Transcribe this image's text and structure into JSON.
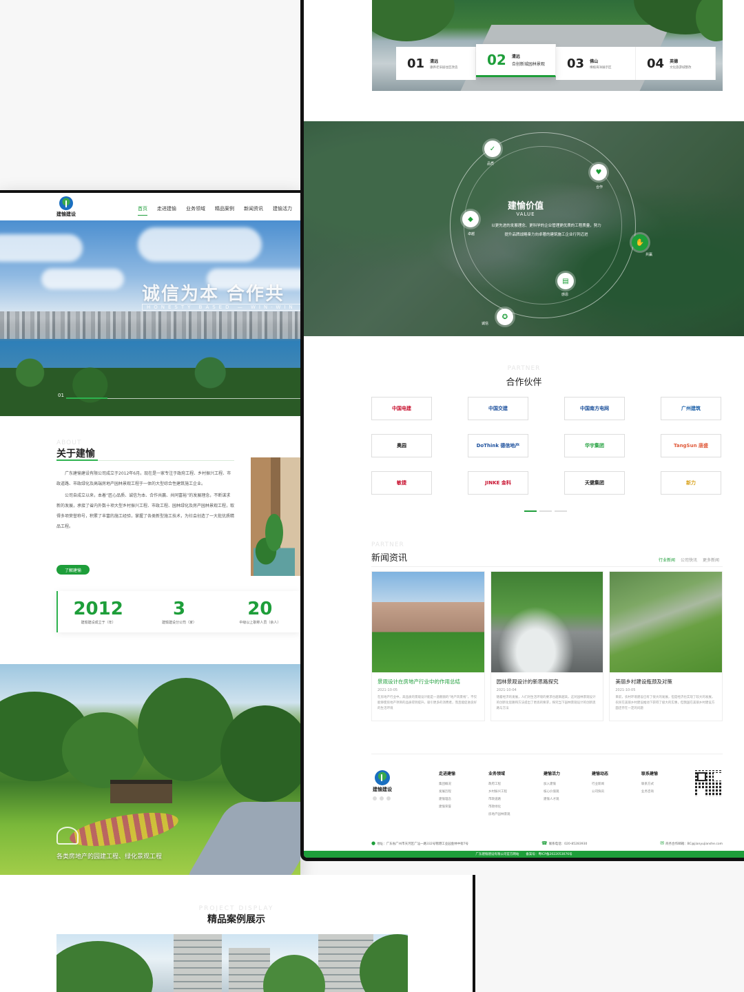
{
  "brand": {
    "name": "建愉建设",
    "green": "#1e9e3a"
  },
  "nav": {
    "items": [
      {
        "label": "首页",
        "active": true
      },
      {
        "label": "走进建愉",
        "active": false
      },
      {
        "label": "业务领域",
        "active": false
      },
      {
        "label": "精品案例",
        "active": false
      },
      {
        "label": "新闻资讯",
        "active": false
      },
      {
        "label": "建愉活力",
        "active": false
      }
    ]
  },
  "hero": {
    "title": "诚信为本 合作共",
    "subtitle": "HONESTY BASED — WIN-WIN COOPER",
    "slide_number": "01"
  },
  "about": {
    "en": "ABOUT",
    "title": "关于建愉",
    "paragraphs": [
      "广东建愉建设有限公司成立于2012年6月。现在是一家专注于政府工程、乡村振兴工程、市政道路、市政绿化及高端房地产园林景观工程于一体的大型综合性建筑施工企业。",
      "公司自成立以来，本着“匠心品质、诚信为本、合作共赢、共同富裕”的发展理念，不断谋求新的发展，承接了省内外数十项大型乡村振兴工程、市政工程、园林绿化及房产园林景观工程，取得多项荣誉称号，积累了丰富的施工经验，掌握了各类新型施工技术，为社会创造了一大批优质精品工程。"
    ],
    "button": "了解建愉",
    "stats": [
      {
        "value": "2012",
        "label": "建愉建设成立于（年）"
      },
      {
        "value": "3",
        "label": "建愉建设分公司（家）"
      },
      {
        "value": "20",
        "label": "中级以上职称人员（余人）"
      }
    ]
  },
  "business": {
    "caption": "各类房地产的园建工程、绿化景观工程"
  },
  "cases": {
    "en": "PROJECT DISPLAY",
    "title": "精品案例展示"
  },
  "projects": {
    "tabs": [
      {
        "num": "01",
        "city": "清远",
        "desc": "康养老旧居住区改造",
        "active": false
      },
      {
        "num": "02",
        "city": "清远",
        "desc": "合创新城园林景观",
        "active": true
      },
      {
        "num": "03",
        "city": "佛山",
        "desc": "樟植海洋展示区",
        "active": false
      },
      {
        "num": "04",
        "city": "英德",
        "desc": "文化旅游城整改",
        "active": false
      }
    ]
  },
  "values": {
    "title": "建愉价值",
    "en": "VALUE",
    "text": "以更先进的发展理念、更科学的企业管理更优质的工程质量，努力提升品牌战略奋力向卓著的建筑施工企业行列迈进",
    "nodes": [
      {
        "label": "品质",
        "icon": "shield-icon",
        "glyph": "✓",
        "active": false
      },
      {
        "label": "合作",
        "icon": "handshake-icon",
        "glyph": "♥",
        "active": false
      },
      {
        "label": "卓越",
        "icon": "diamond-icon",
        "glyph": "◆",
        "active": false
      },
      {
        "label": "共赢",
        "icon": "hands-icon",
        "glyph": "✋",
        "active": true
      },
      {
        "label": "感恩",
        "icon": "document-icon",
        "glyph": "▤",
        "active": false
      },
      {
        "label": "诚信",
        "icon": "medal-icon",
        "glyph": "✪",
        "active": false
      }
    ]
  },
  "partners": {
    "en": "PARTNER",
    "title": "合作伙伴",
    "logos": [
      {
        "name": "中国电建",
        "color": "#c8102e"
      },
      {
        "name": "中国交建",
        "color": "#1b4f9c"
      },
      {
        "name": "中国南方电网",
        "color": "#1a4f9a"
      },
      {
        "name": "广州建筑",
        "color": "#1a5fa8"
      },
      {
        "name": "奥园",
        "color": "#222222"
      },
      {
        "name": "DoThink 德信地产",
        "color": "#1b4f9c"
      },
      {
        "name": "华宇集团",
        "color": "#1e9e3a"
      },
      {
        "name": "TangSun 唐盛",
        "color": "#e05a3a"
      },
      {
        "name": "敏捷",
        "color": "#c8102e"
      },
      {
        "name": "JINKE 金科",
        "color": "#c8102e"
      },
      {
        "name": "天健集团",
        "color": "#222222"
      },
      {
        "name": "新力",
        "color": "#d9a21b"
      }
    ],
    "slider_pages": 3,
    "active_page": 0
  },
  "news": {
    "en": "PARTNER",
    "title": "新闻资讯",
    "tabs": [
      {
        "label": "行业新闻",
        "active": true
      },
      {
        "label": "公司快讯",
        "active": false
      },
      {
        "label": "更多新闻",
        "active": false
      }
    ],
    "items": [
      {
        "title": "景观设计在房地产行业中的作用总结",
        "date": "2021-10-05",
        "summary": "在房地产行业中，高品质的景观设计能是一道靓丽的“地产风景线”，不仅能够使房地产项目的品质得到提升，吸引更多的消费者，而且能促进良好的生活环境",
        "active": true
      },
      {
        "title": "园林景观设计的新思路探究",
        "date": "2021-10-04",
        "summary": "随着经济的发展，人们对生活环境的要求也越来越高，这对园林景观设计的创新化思路和方法提出了更高的要求，探究当下园林景观设计的创新思路与方法",
        "active": false
      },
      {
        "title": "美丽乡村建设瓶颈及对策",
        "date": "2021-10-05",
        "summary": "目前，农村环境建设已有了很大的发展，但是经济也实现了较大的发展，农民在美丽乡村建设推动下获得了极大的实惠，但我国在美丽乡村建设方面还存在一定的问题",
        "active": false
      }
    ]
  },
  "footer": {
    "columns": [
      {
        "title": "走进建愉",
        "items": [
          "集团概况",
          "发展历程",
          "建愉理念",
          "建愉荣誉"
        ]
      },
      {
        "title": "业务领域",
        "items": [
          "政府工程",
          "乡村振兴工程",
          "市政道路",
          "市政绿化",
          "房地产园林景观"
        ]
      },
      {
        "title": "建愉活力",
        "items": [
          "加入建愉",
          "核心价值观",
          "建愉人才观"
        ]
      },
      {
        "title": "建愉动态",
        "items": [
          "行业新闻",
          "公司快讯"
        ]
      },
      {
        "title": "联系建愉",
        "items": [
          "联系方式",
          "业务咨询"
        ]
      }
    ],
    "address": "地址：广东省广州市天河区广汕一路332号锦港工业园金林中街7号",
    "phone": "联系电话：020-85283930",
    "email": "商务合作邮箱：BC@jianyujianshe.com",
    "copyright": "广东建愉建设有限公司官方网站",
    "icp": "备案号：粤ICP备2022053076号"
  }
}
